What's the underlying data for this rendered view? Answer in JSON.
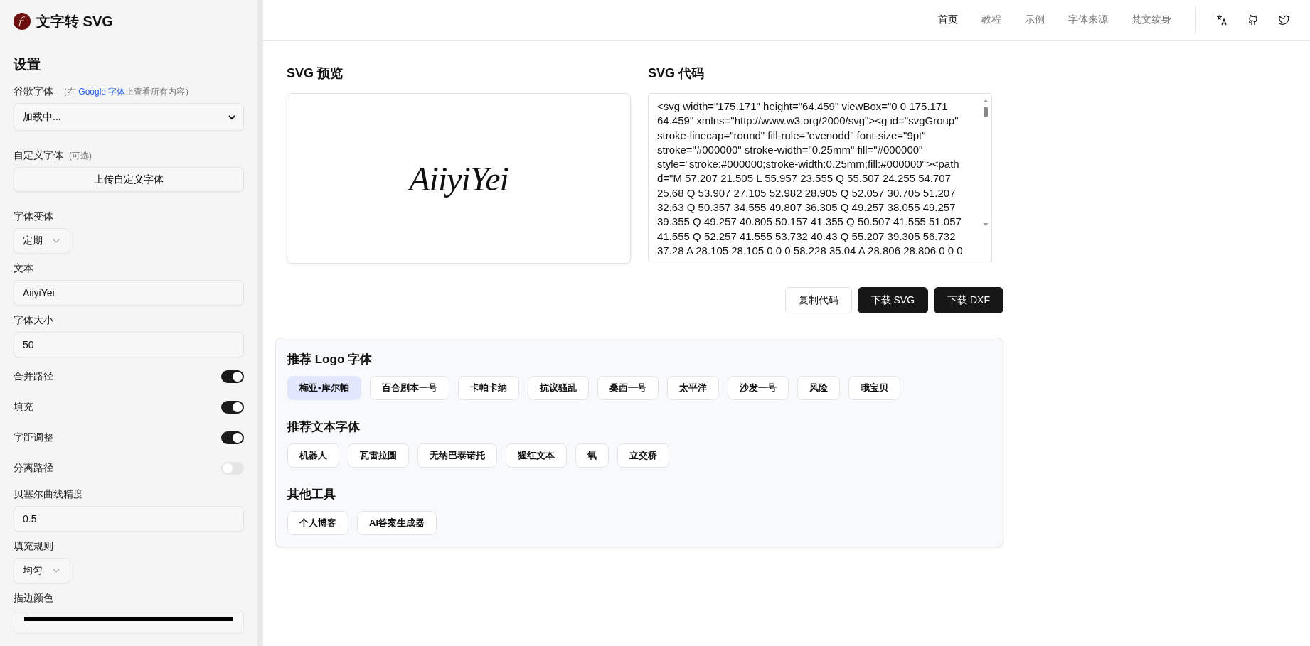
{
  "app": {
    "title": "文字转 SVG"
  },
  "nav": {
    "items": [
      {
        "label": "首页",
        "selected": true
      },
      {
        "label": "教程",
        "selected": false
      },
      {
        "label": "示例",
        "selected": false
      },
      {
        "label": "字体来源",
        "selected": false
      },
      {
        "label": "梵文纹身",
        "selected": false
      }
    ]
  },
  "settings": {
    "heading": "设置",
    "fields": [
      {
        "kind": "select",
        "label": "谷歌字体",
        "note_before": "（在 ",
        "link": "Google 字体",
        "note_after": "上查看所有内容）",
        "value": "加载中..."
      },
      {
        "kind": "upload",
        "label": "自定义字体",
        "note": "(可选)",
        "button": "上传自定义字体"
      },
      {
        "kind": "small-select",
        "label": "字体变体",
        "value": "定期"
      },
      {
        "kind": "input",
        "label": "文本",
        "value": "AiiyiYei"
      },
      {
        "kind": "input",
        "label": "字体大小",
        "value": "50"
      },
      {
        "kind": "toggle",
        "label": "合并路径",
        "on": true
      },
      {
        "kind": "toggle",
        "label": "填充",
        "on": true
      },
      {
        "kind": "toggle",
        "label": "字距调整",
        "on": true
      },
      {
        "kind": "toggle",
        "label": "分离路径",
        "on": false
      },
      {
        "kind": "input",
        "label": "贝塞尔曲线精度",
        "value": "0.5"
      },
      {
        "kind": "small-select",
        "label": "填充规则",
        "value": "均匀"
      },
      {
        "kind": "color",
        "label": "描边颜色",
        "color": "#000000"
      }
    ]
  },
  "preview": {
    "title": "SVG 预览",
    "text": "AiiyiYei"
  },
  "code": {
    "title": "SVG 代码",
    "value": "<svg width=\"175.171\" height=\"64.459\" viewBox=\"0 0 175.171 64.459\" xmlns=\"http://www.w3.org/2000/svg\"><g id=\"svgGroup\" stroke-linecap=\"round\" fill-rule=\"evenodd\" font-size=\"9pt\" stroke=\"#000000\" stroke-width=\"0.25mm\" fill=\"#000000\" style=\"stroke:#000000;stroke-width:0.25mm;fill:#000000\"><path d=\"M 57.207 21.505 L 55.957 23.555 Q 55.507 24.255 54.707 25.68 Q 53.907 27.105 52.982 28.905 Q 52.057 30.705 51.207 32.63 Q 50.357 34.555 49.807 36.305 Q 49.257 38.055 49.257 39.355 Q 49.257 40.805 50.157 41.355 Q 50.507 41.555 51.057 41.555 Q 52.257 41.555 53.732 40.43 Q 55.207 39.305 56.732 37.28 A 28.105 28.105 0 0 0 58.228 35.04 A 28.806 28.806 0 0 0"
  },
  "actions": [
    {
      "kind": "outline",
      "label": "复制代码"
    },
    {
      "kind": "solid",
      "label": "下载 SVG"
    },
    {
      "kind": "solid",
      "label": "下载 DXF"
    }
  ],
  "sections": [
    {
      "title": "推荐 Logo 字体",
      "chips": [
        {
          "label": "梅亚•库尔帕",
          "selected": true
        },
        {
          "label": "百合剧本一号",
          "selected": false
        },
        {
          "label": "卡帕卡纳",
          "selected": false
        },
        {
          "label": "抗议骚乱",
          "selected": false
        },
        {
          "label": "桑西一号",
          "selected": false
        },
        {
          "label": "太平洋",
          "selected": false
        },
        {
          "label": "沙发一号",
          "selected": false
        },
        {
          "label": "风险",
          "selected": false
        },
        {
          "label": "哦宝贝",
          "selected": false
        }
      ]
    },
    {
      "title": "推荐文本字体",
      "chips": [
        {
          "label": "机器人",
          "selected": false
        },
        {
          "label": "瓦雷拉圆",
          "selected": false
        },
        {
          "label": "无纳巴泰诺托",
          "selected": false
        },
        {
          "label": "猩红文本",
          "selected": false
        },
        {
          "label": "氧",
          "selected": false
        },
        {
          "label": "立交桥",
          "selected": false
        }
      ]
    },
    {
      "title": "其他工具",
      "chips": [
        {
          "label": "个人博客",
          "selected": false
        },
        {
          "label": "AI答案生成器",
          "selected": false
        }
      ]
    }
  ]
}
